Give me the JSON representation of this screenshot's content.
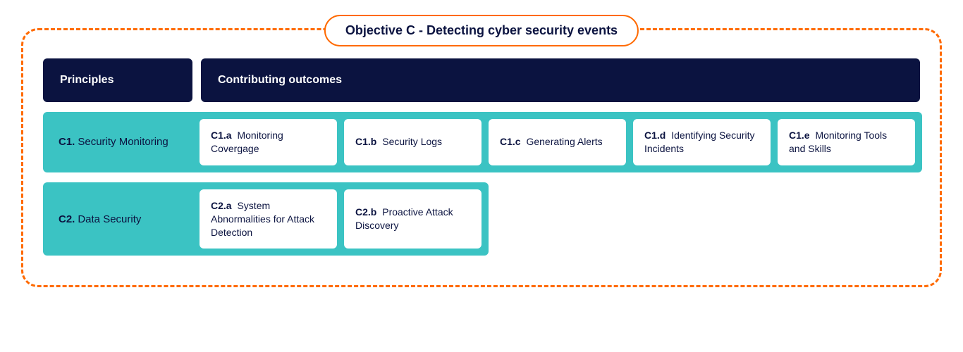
{
  "title": "Objective C - Detecting cyber security events",
  "headers": {
    "principles": "Principles",
    "outcomes": "Contributing outcomes"
  },
  "rows": [
    {
      "code": "C1.",
      "label": "Security Monitoring",
      "full": true,
      "outcomes": [
        {
          "code": "C1.a",
          "label": "Monitoring Covergage"
        },
        {
          "code": "C1.b",
          "label": "Security Logs"
        },
        {
          "code": "C1.c",
          "label": "Generating Alerts"
        },
        {
          "code": "C1.d",
          "label": "Identifying Security Incidents"
        },
        {
          "code": "C1.e",
          "label": "Monitoring Tools and Skills"
        }
      ]
    },
    {
      "code": "C2.",
      "label": "Data Security",
      "full": false,
      "outcomes": [
        {
          "code": "C2.a",
          "label": "System Abnormalities for Attack Detection"
        },
        {
          "code": "C2.b",
          "label": "Proactive Attack Discovery"
        }
      ]
    }
  ]
}
